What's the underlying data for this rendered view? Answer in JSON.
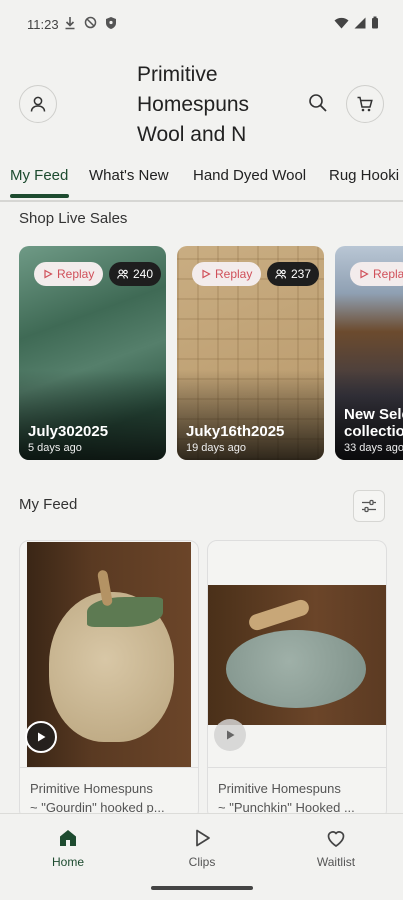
{
  "status_bar": {
    "time": "11:23"
  },
  "header": {
    "title_lines": [
      "Primitive",
      "Homespuns",
      "Wool and N"
    ]
  },
  "tabs": [
    {
      "label": "My Feed"
    },
    {
      "label": "What's New"
    },
    {
      "label": "Hand Dyed Wool"
    },
    {
      "label": "Rug Hooki"
    }
  ],
  "live_sales": {
    "title": "Shop Live Sales",
    "cards": [
      {
        "replay_label": "Replay",
        "count": "240",
        "name": "July302025",
        "ago": "5 days ago"
      },
      {
        "replay_label": "Replay",
        "count": "237",
        "name": "Juky16th2025",
        "ago": "19 days ago"
      },
      {
        "replay_label": "Repla",
        "name_line1": "New Sele",
        "name_line2": "collectio",
        "ago": "33 days ago"
      }
    ]
  },
  "feed": {
    "title": "My Feed",
    "cards": [
      {
        "line1": "Primitive Homespuns",
        "line2": "~ \"Gourdin\" hooked p..."
      },
      {
        "line1": "Primitive Homespuns",
        "line2": "~ \"Punchkin\" Hooked ..."
      }
    ]
  },
  "bottom_nav": [
    {
      "label": "Home",
      "icon": "home-icon"
    },
    {
      "label": "Clips",
      "icon": "play-icon"
    },
    {
      "label": "Waitlist",
      "icon": "heart-icon"
    }
  ],
  "colors": {
    "accent": "#1d4b2f",
    "replay_text": "#d0505a",
    "background": "#f2f2f0"
  }
}
